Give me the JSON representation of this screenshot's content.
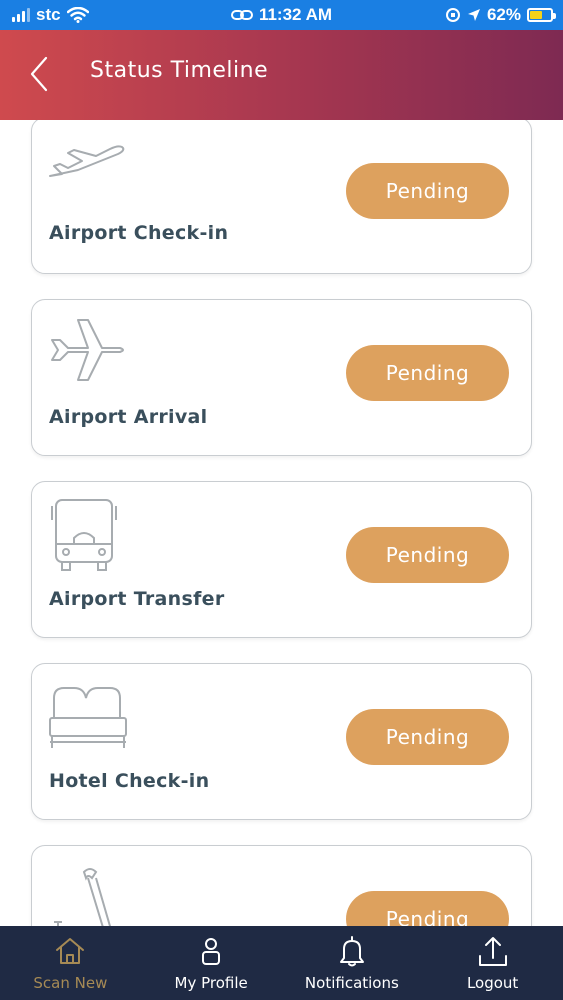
{
  "status_bar": {
    "carrier": "stc",
    "time": "11:32 AM",
    "battery": "62%",
    "battery_level": 0.62
  },
  "header": {
    "title": "Status Timeline"
  },
  "timeline": [
    {
      "label": "Airport Check-in",
      "status": "Pending",
      "icon": "plane-departure-icon"
    },
    {
      "label": "Airport Arrival",
      "status": "Pending",
      "icon": "plane-icon"
    },
    {
      "label": "Airport Transfer",
      "status": "Pending",
      "icon": "bus-icon"
    },
    {
      "label": "Hotel Check-in",
      "status": "Pending",
      "icon": "bed-icon"
    },
    {
      "label": "",
      "status": "Pending",
      "icon": "crutch-icon"
    }
  ],
  "bottom_nav": [
    {
      "label": "Scan New",
      "icon": "home-icon",
      "active": true
    },
    {
      "label": "My Profile",
      "icon": "profile-icon",
      "active": false
    },
    {
      "label": "Notifications",
      "icon": "bell-icon",
      "active": false
    },
    {
      "label": "Logout",
      "icon": "upload-icon",
      "active": false
    }
  ],
  "colors": {
    "status_bar": "#1a7fe3",
    "header_start": "#cf4a4e",
    "header_end": "#7e2a52",
    "pending": "#dda15e",
    "nav_bg": "#1f2a44",
    "nav_active": "#a68a55"
  }
}
